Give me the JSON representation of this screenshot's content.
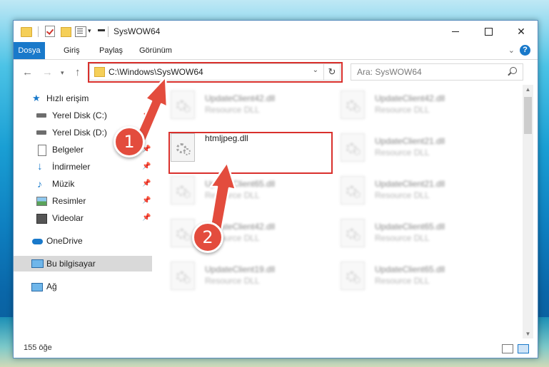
{
  "window": {
    "title": "SysWOW64",
    "minimize_icon": "minimize-icon",
    "maximize_icon": "maximize-icon",
    "close_glyph": "✕"
  },
  "ribbon": {
    "tabs": [
      {
        "label": "Dosya",
        "active": true
      },
      {
        "label": "Giriş"
      },
      {
        "label": "Paylaş"
      },
      {
        "label": "Görünüm"
      }
    ],
    "expand_glyph": "⌄",
    "help_glyph": "?"
  },
  "nav": {
    "back_glyph": "←",
    "forward_glyph": "→",
    "recent_glyph": "▾",
    "up_glyph": "↑",
    "address": "C:\\Windows\\SysWOW64",
    "address_dropdown_glyph": "⌄",
    "refresh_glyph": "↻",
    "search_placeholder": "Ara: SysWOW64"
  },
  "sidebar": {
    "items": [
      {
        "label": "Hızlı erişim",
        "icon": "star-icon",
        "pinned": false
      },
      {
        "label": "Yerel Disk (C:)",
        "icon": "drive-icon",
        "pinned": true
      },
      {
        "label": "Yerel Disk (D:)",
        "icon": "drive-icon",
        "pinned": true
      },
      {
        "label": "Belgeler",
        "icon": "documents-icon",
        "pinned": true
      },
      {
        "label": "İndirmeler",
        "icon": "download-icon",
        "pinned": true
      },
      {
        "label": "Müzik",
        "icon": "music-icon",
        "pinned": true
      },
      {
        "label": "Resimler",
        "icon": "pictures-icon",
        "pinned": true
      },
      {
        "label": "Videolar",
        "icon": "videos-icon",
        "pinned": true
      },
      {
        "label": "OneDrive",
        "icon": "cloud-icon",
        "pinned": false
      },
      {
        "label": "Bu bilgisayar",
        "icon": "computer-icon",
        "pinned": false,
        "selected": true
      },
      {
        "label": "Ağ",
        "icon": "network-icon",
        "pinned": false
      }
    ],
    "pin_glyph": "📌"
  },
  "files": {
    "left": [
      {
        "name": "UpdateClient42.dll",
        "type": "Resource DLL",
        "blurred": true
      },
      {
        "name": "htmljpeg.dll",
        "type": "",
        "blurred": false,
        "highlighted": true
      },
      {
        "name": "UpdateClient65.dll",
        "type": "Resource DLL",
        "blurred": true
      },
      {
        "name": "UpdateClient42.dll",
        "type": "Resource DLL",
        "blurred": true
      },
      {
        "name": "UpdateClient19.dll",
        "type": "Resource DLL",
        "blurred": true
      }
    ],
    "right": [
      {
        "name": "UpdateClient42.dll",
        "type": "Resource DLL",
        "blurred": true
      },
      {
        "name": "UpdateClient21.dll",
        "type": "Resource DLL",
        "blurred": true
      },
      {
        "name": "UpdateClient21.dll",
        "type": "Resource DLL",
        "blurred": true
      },
      {
        "name": "UpdateClient65.dll",
        "type": "Resource DLL",
        "blurred": true
      },
      {
        "name": "UpdateClient65.dll",
        "type": "Resource DLL",
        "blurred": true
      }
    ]
  },
  "status": {
    "item_count": "155 öğe"
  },
  "annotations": {
    "step1": "1",
    "step2": "2",
    "highlight_color": "#d9302c",
    "badge_color": "#e34c3d"
  }
}
